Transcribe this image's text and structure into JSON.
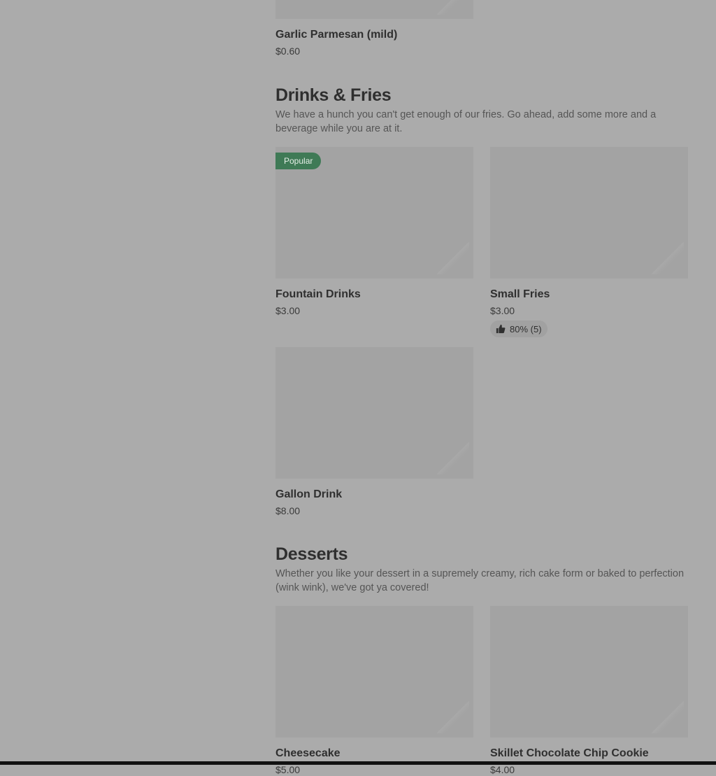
{
  "top_item": {
    "name": "Garlic Parmesan (mild)",
    "price": "$0.60"
  },
  "sections": [
    {
      "title": "Drinks & Fries",
      "description": "We have a hunch you can't get enough of our fries. Go ahead, add some more and a beverage while you are at it.",
      "items": [
        {
          "name": "Fountain Drinks",
          "price": "$3.00",
          "badge": "Popular"
        },
        {
          "name": "Small Fries",
          "price": "$3.00",
          "rating": "80% (5)"
        },
        {
          "name": "Gallon Drink",
          "price": "$8.00"
        }
      ]
    },
    {
      "title": "Desserts",
      "description": "Whether you like your dessert in a supremely creamy, rich cake form or baked to perfection (wink wink), we've got ya covered!",
      "items": [
        {
          "name": "Cheesecake",
          "price": "$5.00"
        },
        {
          "name": "Skillet Chocolate Chip Cookie",
          "price": "$4.00"
        }
      ]
    }
  ],
  "icons": {
    "rating": "thumbs-up-icon"
  },
  "colors": {
    "overlay_bg": "#ababab",
    "badge_bg": "#3f7a56"
  }
}
